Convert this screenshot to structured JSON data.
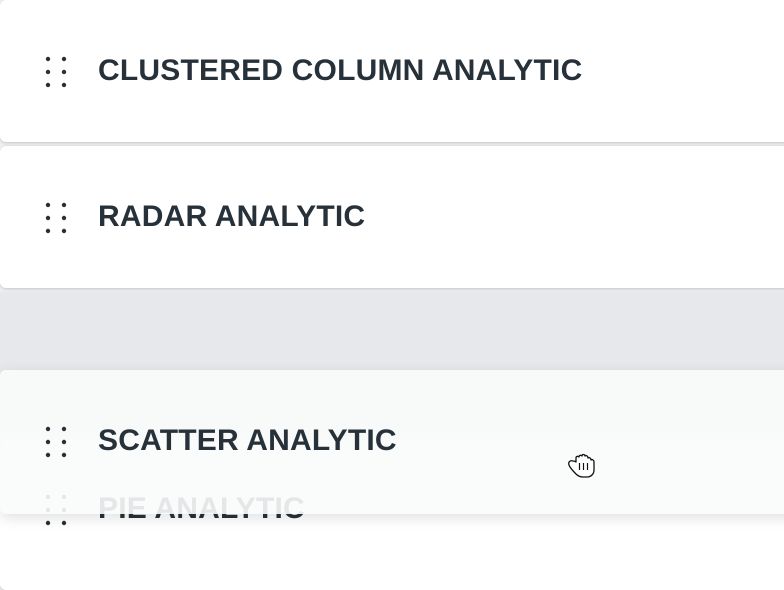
{
  "items": [
    {
      "label": "CLUSTERED COLUMN ANALYTIC",
      "icon": "drag-handle-icon"
    },
    {
      "label": "RADAR ANALYTIC",
      "icon": "drag-handle-icon"
    },
    {
      "label": "PIE ANALYTIC",
      "icon": "drag-handle-icon"
    }
  ],
  "dragging": {
    "label": "SCATTER ANALYTIC",
    "icon": "drag-handle-icon"
  },
  "cursor": {
    "icon": "grabbing-hand-icon"
  },
  "colors": {
    "text": "#27313a",
    "card": "#ffffff",
    "page_bg": "#eef0f2",
    "placeholder": "#e6e8eb"
  }
}
